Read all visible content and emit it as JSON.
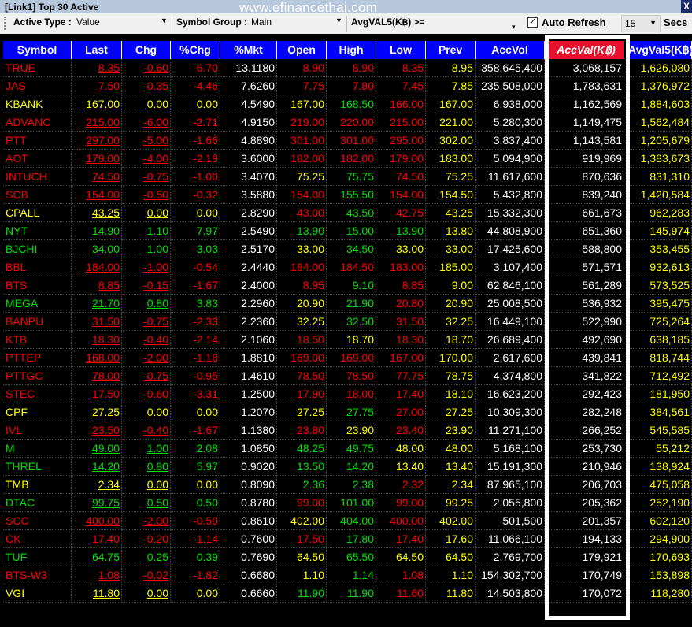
{
  "window": {
    "title": "[Link1] Top 30 Active",
    "watermark": "www.efinancethai.com",
    "close": "X"
  },
  "toolbar": {
    "active_type_label": "Active Type :",
    "active_type_value": "Value",
    "symbol_group_label": "Symbol Group :",
    "symbol_group_value": "Main",
    "avgval_filter_label": "AvgVAL5(K฿) >=",
    "avgval_filter_value": "",
    "auto_refresh_label": "Auto Refresh",
    "auto_refresh_checked": true,
    "refresh_interval": "15",
    "secs_label": "Secs"
  },
  "columns": [
    "Symbol",
    "Last",
    "Chg",
    "%Chg",
    "%Mkt",
    "Open",
    "High",
    "Low",
    "Prev",
    "AccVol",
    "AccVal(K฿)",
    "AvgVal5(K฿)"
  ],
  "sorted_column": "AccVal(K฿)",
  "colors": {
    "up": "#00e000",
    "down": "#ff0000",
    "unchanged": "#ffff00",
    "neutral": "#ffffff",
    "header": "#0000ff",
    "sorted_header": "#e8102c"
  },
  "rows": [
    [
      "TRUE",
      "8.35",
      "-0.60",
      "-6.70",
      "13.1180",
      "8.90",
      "8.90",
      "8.35",
      "8.95",
      "358,645,400",
      "3,068,157",
      "1,626,080"
    ],
    [
      "JAS",
      "7.50",
      "-0.35",
      "-4.46",
      "7.6260",
      "7.75",
      "7.80",
      "7.45",
      "7.85",
      "235,508,000",
      "1,783,631",
      "1,376,972"
    ],
    [
      "KBANK",
      "167.00",
      "0.00",
      "0.00",
      "4.5490",
      "167.00",
      "168.50",
      "166.00",
      "167.00",
      "6,938,000",
      "1,162,569",
      "1,884,603"
    ],
    [
      "ADVANC",
      "215.00",
      "-6.00",
      "-2.71",
      "4.9150",
      "219.00",
      "220.00",
      "215.00",
      "221.00",
      "5,280,300",
      "1,149,475",
      "1,562,484"
    ],
    [
      "PTT",
      "297.00",
      "-5.00",
      "-1.66",
      "4.8890",
      "301.00",
      "301.00",
      "295.00",
      "302.00",
      "3,837,400",
      "1,143,581",
      "1,205,679"
    ],
    [
      "AOT",
      "179.00",
      "-4.00",
      "-2.19",
      "3.6000",
      "182.00",
      "182.00",
      "179.00",
      "183.00",
      "5,094,900",
      "919,969",
      "1,383,673"
    ],
    [
      "INTUCH",
      "74.50",
      "-0.75",
      "-1.00",
      "3.4070",
      "75.25",
      "75.75",
      "74.50",
      "75.25",
      "11,617,600",
      "870,636",
      "831,310"
    ],
    [
      "SCB",
      "154.00",
      "-0.50",
      "-0.32",
      "3.5880",
      "154.00",
      "155.50",
      "154.00",
      "154.50",
      "5,432,800",
      "839,240",
      "1,420,584"
    ],
    [
      "CPALL",
      "43.25",
      "0.00",
      "0.00",
      "2.8290",
      "43.00",
      "43.50",
      "42.75",
      "43.25",
      "15,332,300",
      "661,673",
      "962,283"
    ],
    [
      "NYT",
      "14.90",
      "1.10",
      "7.97",
      "2.5490",
      "13.90",
      "15.00",
      "13.90",
      "13.80",
      "44,808,900",
      "651,360",
      "145,974"
    ],
    [
      "BJCHI",
      "34.00",
      "1.00",
      "3.03",
      "2.5170",
      "33.00",
      "34.50",
      "33.00",
      "33.00",
      "17,425,600",
      "588,800",
      "353,455"
    ],
    [
      "BBL",
      "184.00",
      "-1.00",
      "-0.54",
      "2.4440",
      "184.00",
      "184.50",
      "183.00",
      "185.00",
      "3,107,400",
      "571,571",
      "932,613"
    ],
    [
      "BTS",
      "8.85",
      "-0.15",
      "-1.67",
      "2.4000",
      "8.95",
      "9.10",
      "8.85",
      "9.00",
      "62,846,100",
      "561,289",
      "573,525"
    ],
    [
      "MEGA",
      "21.70",
      "0.80",
      "3.83",
      "2.2960",
      "20.90",
      "21.90",
      "20.80",
      "20.90",
      "25,008,500",
      "536,932",
      "395,475"
    ],
    [
      "BANPU",
      "31.50",
      "-0.75",
      "-2.33",
      "2.2360",
      "32.25",
      "32.50",
      "31.50",
      "32.25",
      "16,449,100",
      "522,990",
      "725,264"
    ],
    [
      "KTB",
      "18.30",
      "-0.40",
      "-2.14",
      "2.1060",
      "18.50",
      "18.70",
      "18.30",
      "18.70",
      "26,689,400",
      "492,690",
      "638,185"
    ],
    [
      "PTTEP",
      "168.00",
      "-2.00",
      "-1.18",
      "1.8810",
      "169.00",
      "169.00",
      "167.00",
      "170.00",
      "2,617,600",
      "439,841",
      "818,744"
    ],
    [
      "PTTGC",
      "78.00",
      "-0.75",
      "-0.95",
      "1.4610",
      "78.50",
      "78.50",
      "77.75",
      "78.75",
      "4,374,800",
      "341,822",
      "712,492"
    ],
    [
      "STEC",
      "17.50",
      "-0.60",
      "-3.31",
      "1.2500",
      "17.90",
      "18.00",
      "17.40",
      "18.10",
      "16,623,200",
      "292,423",
      "181,950"
    ],
    [
      "CPF",
      "27.25",
      "0.00",
      "0.00",
      "1.2070",
      "27.25",
      "27.75",
      "27.00",
      "27.25",
      "10,309,300",
      "282,248",
      "384,561"
    ],
    [
      "IVL",
      "23.50",
      "-0.40",
      "-1.67",
      "1.1380",
      "23.80",
      "23.90",
      "23.40",
      "23.90",
      "11,271,100",
      "266,252",
      "545,585"
    ],
    [
      "M",
      "49.00",
      "1.00",
      "2.08",
      "1.0850",
      "48.25",
      "49.75",
      "48.00",
      "48.00",
      "5,168,100",
      "253,730",
      "55,212"
    ],
    [
      "THREL",
      "14.20",
      "0.80",
      "5.97",
      "0.9020",
      "13.50",
      "14.20",
      "13.40",
      "13.40",
      "15,191,300",
      "210,946",
      "138,924"
    ],
    [
      "TMB",
      "2.34",
      "0.00",
      "0.00",
      "0.8090",
      "2.36",
      "2.38",
      "2.32",
      "2.34",
      "87,965,100",
      "206,703",
      "475,058"
    ],
    [
      "DTAC",
      "99.75",
      "0.50",
      "0.50",
      "0.8780",
      "99.00",
      "101.00",
      "99.00",
      "99.25",
      "2,055,800",
      "205,362",
      "252,190"
    ],
    [
      "SCC",
      "400.00",
      "-2.00",
      "-0.50",
      "0.8610",
      "402.00",
      "404.00",
      "400.00",
      "402.00",
      "501,500",
      "201,357",
      "602,120"
    ],
    [
      "CK",
      "17.40",
      "-0.20",
      "-1.14",
      "0.7600",
      "17.50",
      "17.80",
      "17.40",
      "17.60",
      "11,066,100",
      "194,133",
      "294,900"
    ],
    [
      "TUF",
      "64.75",
      "0.25",
      "0.39",
      "0.7690",
      "64.50",
      "65.50",
      "64.50",
      "64.50",
      "2,769,700",
      "179,921",
      "170,693"
    ],
    [
      "BTS-W3",
      "1.08",
      "-0.02",
      "-1.82",
      "0.6680",
      "1.10",
      "1.14",
      "1.08",
      "1.10",
      "154,302,700",
      "170,749",
      "153,898"
    ],
    [
      "VGI",
      "11.80",
      "0.00",
      "0.00",
      "0.6660",
      "11.90",
      "11.90",
      "11.60",
      "11.80",
      "14,503,800",
      "170,072",
      "118,280"
    ]
  ]
}
